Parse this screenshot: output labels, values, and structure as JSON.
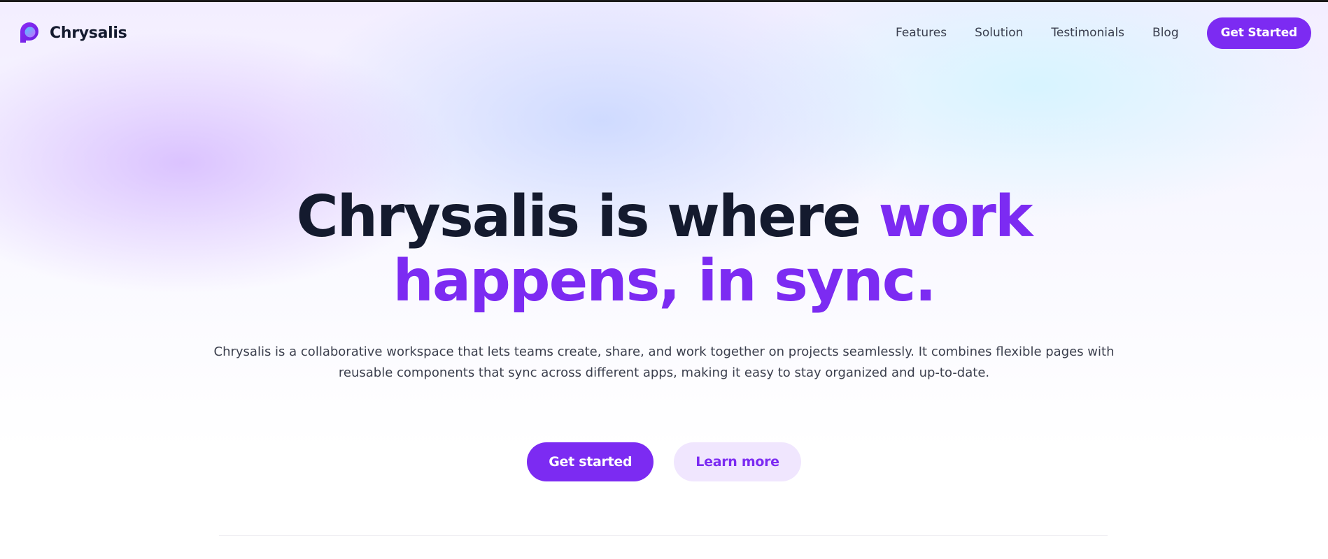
{
  "brand": {
    "name": "Chrysalis",
    "logo_icon": "chrysalis-logo-icon"
  },
  "nav": {
    "links": [
      "Features",
      "Solution",
      "Testimonials",
      "Blog"
    ],
    "cta_label": "Get Started"
  },
  "hero": {
    "title_part1": "Chrysalis is where ",
    "title_accent_line1": "work",
    "title_accent_line2": "happens, in sync.",
    "description": "Chrysalis is a collaborative workspace that lets teams create, share, and work together on projects seamlessly. It combines flexible pages with reusable components that sync across different apps, making it easy to stay organized and up-to-date.",
    "primary_label": "Get started",
    "secondary_label": "Learn more"
  },
  "colors": {
    "accent": "#7c2bf2",
    "accent_soft": "#f0e6fe",
    "text_dark": "#141a2e",
    "text_body": "#3b3f4d"
  }
}
